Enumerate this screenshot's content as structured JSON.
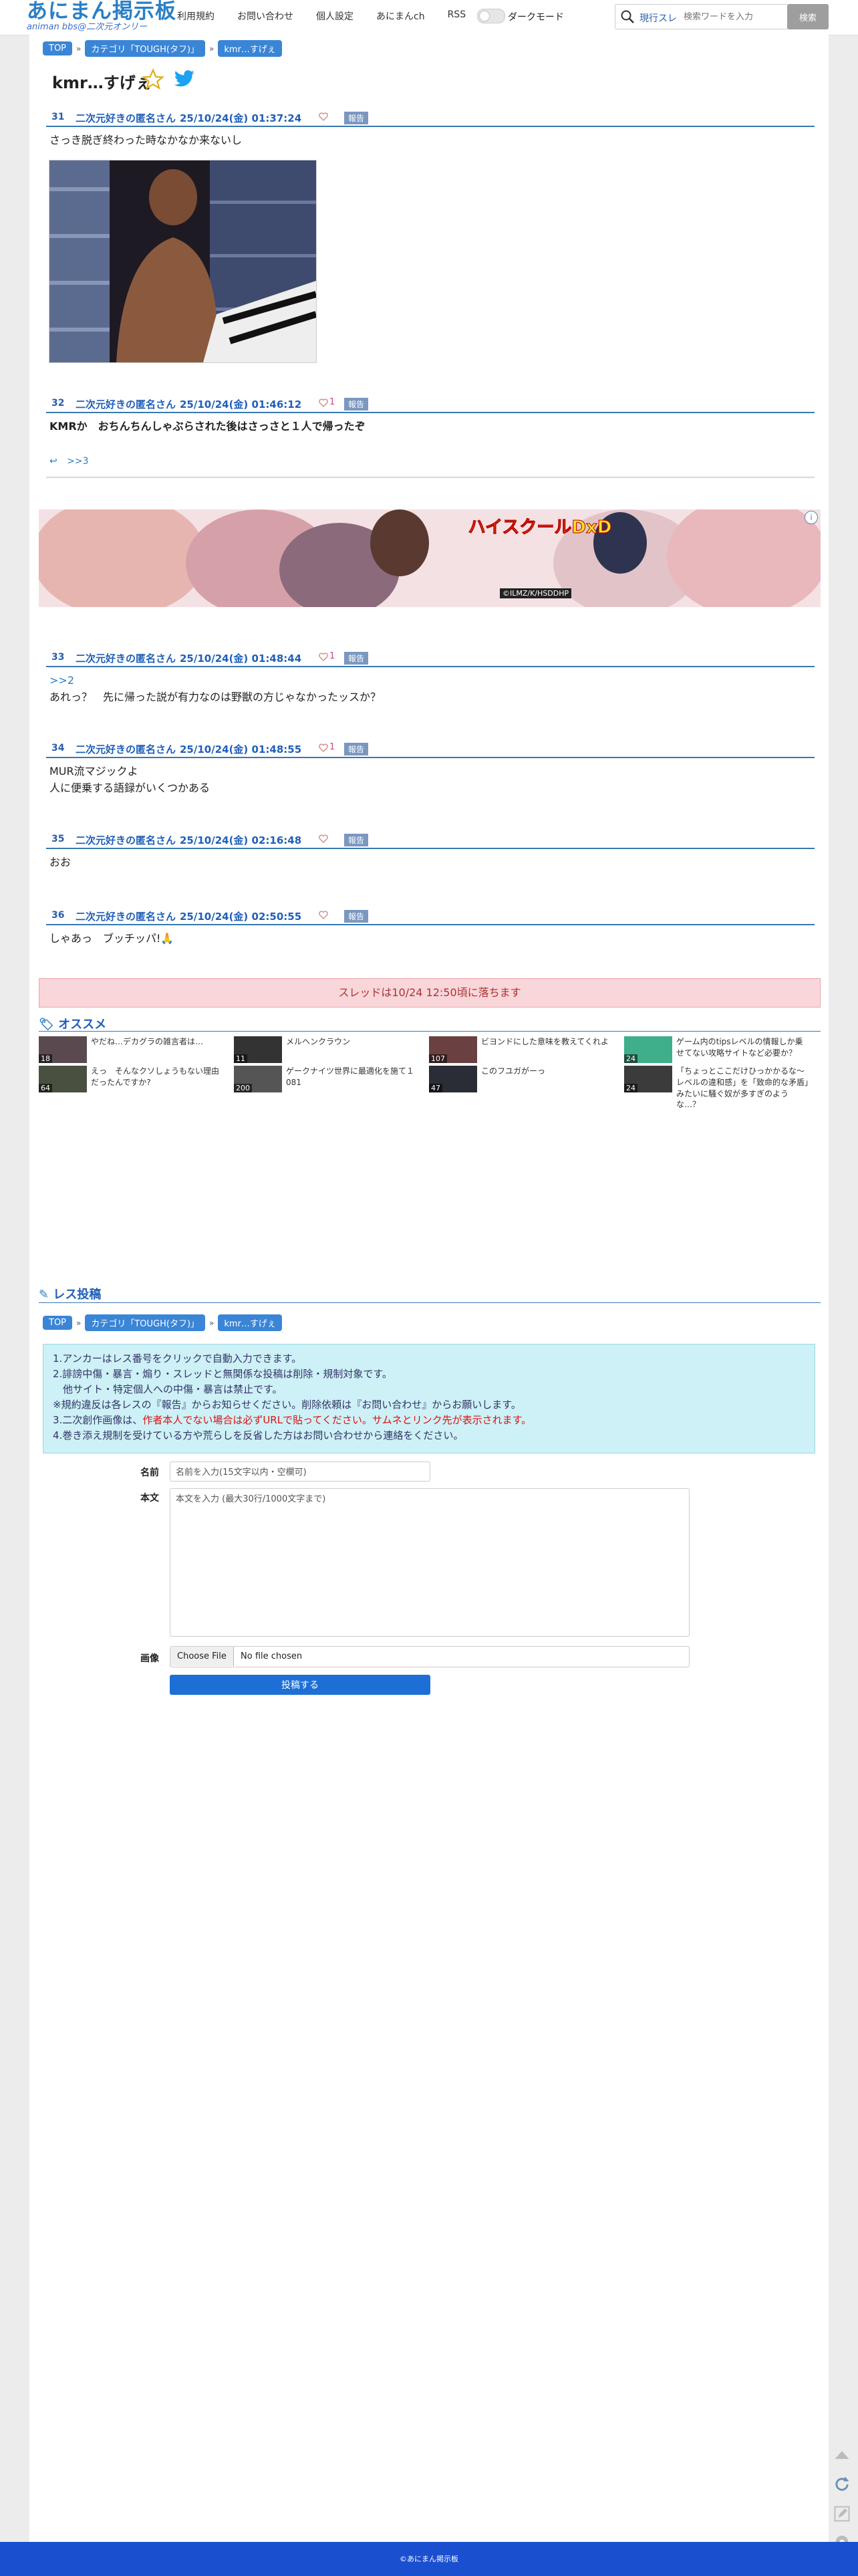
{
  "header": {
    "logo_main": "あにまん掲示板",
    "logo_sub": "animan bbs@二次元オンリー",
    "nav": [
      "利用規約",
      "お問い合わせ",
      "個人設定",
      "あにまんch",
      "RSS"
    ],
    "dark_mode_label": "ダークモード",
    "search_scope": "現行スレ",
    "search_placeholder": "検索ワードを入力",
    "search_button": "検索"
  },
  "breadcrumb": [
    "TOP",
    "カテゴリ「TOUGH(タフ)」",
    "kmr…すげぇ"
  ],
  "thread_title": "kmr…すげぇ",
  "posts": [
    {
      "num": "31",
      "name": "二次元好きの匿名さん",
      "date": "25/10/24(金) 01:37:24",
      "likes": "",
      "report": "報告",
      "body": [
        "さっき脱ぎ終わった時なかなか来ないし"
      ]
    },
    {
      "num": "32",
      "name": "二次元好きの匿名さん",
      "date": "25/10/24(金) 01:46:12",
      "likes": "1",
      "report": "報告",
      "body": [
        "KMRか　おちんちんしゃぶらされた後はさっさと１人で帰ったぞ"
      ]
    },
    {
      "num": "33",
      "name": "二次元好きの匿名さん",
      "date": "25/10/24(金) 01:48:44",
      "likes": "1",
      "report": "報告",
      "anchor": ">>2",
      "body": [
        "あれっ？　先に帰った説が有力なのは野獣の方じゃなかったッスか？"
      ]
    },
    {
      "num": "34",
      "name": "二次元好きの匿名さん",
      "date": "25/10/24(金) 01:48:55",
      "likes": "1",
      "report": "報告",
      "body": [
        "MUR流マジックよ",
        "人に便乗する語録がいくつかある"
      ]
    },
    {
      "num": "35",
      "name": "二次元好きの匿名さん",
      "date": "25/10/24(金) 02:16:48",
      "likes": "",
      "report": "報告",
      "body": [
        "おお"
      ]
    },
    {
      "num": "36",
      "name": "二次元好きの匿名さん",
      "date": "25/10/24(金) 02:50:55",
      "likes": "",
      "report": "報告",
      "body": [
        "しゃあっ　ブッチッパ!🙏"
      ]
    }
  ],
  "reply_link": ">>3",
  "banner_text": "ハイスクールDxD",
  "banner_credit": "©ILMZ/K/HSDDHP",
  "closed_notice": "スレッドは10/24 12:50頃に落ちます",
  "recommend": {
    "title": "オススメ",
    "items": [
      {
        "title": "やだね…デカグラの雑言者は…",
        "count": "18"
      },
      {
        "title": "メルヘンクラウン",
        "count": "11"
      },
      {
        "title": "ビヨンドにした意味を教えてくれよ",
        "count": "107"
      },
      {
        "title": "ゲーム内のtipsレベルの情報しか乗せてない攻略サイトなど必要か？",
        "count": "24"
      },
      {
        "title": "えっ　そんなクソしょうもない理由だったんですか?",
        "count": "64"
      },
      {
        "title": "ゲークナイツ世界に最適化を施て１081",
        "count": "200"
      },
      {
        "title": "このフユガがーっ",
        "count": "47"
      },
      {
        "title": "「ちょっとここだけひっかかるな〜レベルの違和感」を「致命的な矛盾」みたいに騒ぐ奴が多すぎのような…？",
        "count": "24"
      }
    ]
  },
  "reply_form": {
    "title": "レス投稿",
    "notice_lines": [
      "1.アンカーはレス番号をクリックで自動入力できます。",
      "2.誹謗中傷・暴言・煽り・スレッドと無関係な投稿は削除・規制対象です。",
      "　他サイト・特定個人への中傷・暴言は禁止です。",
      "※規約違反は各レスの『報告』からお知らせください。削除依頼は『お問い合わせ』からお願いします。"
    ],
    "notice_red_prefix": "3.二次創作画像は、",
    "notice_red_text": "作者本人でない場合は必ずURLで貼ってください。サムネとリンク先が表示されます。",
    "notice_last": "4.巻き添え規制を受けている方や荒らしを反省した方はお問い合わせから連絡をください。",
    "name_label": "名前",
    "name_placeholder": "名前を入力(15文字以内・空欄可)",
    "body_label": "本文",
    "body_placeholder": "本文を入力 (最大30行/1000文字まで)",
    "image_label": "画像",
    "file_button": "Choose File",
    "file_status": "No file chosen",
    "submit": "投稿する"
  },
  "footer": "©あにまん掲示板",
  "colors": {
    "accent": "#3a85d6",
    "footer": "#1a4fd0",
    "link": "#1f5fb8"
  }
}
